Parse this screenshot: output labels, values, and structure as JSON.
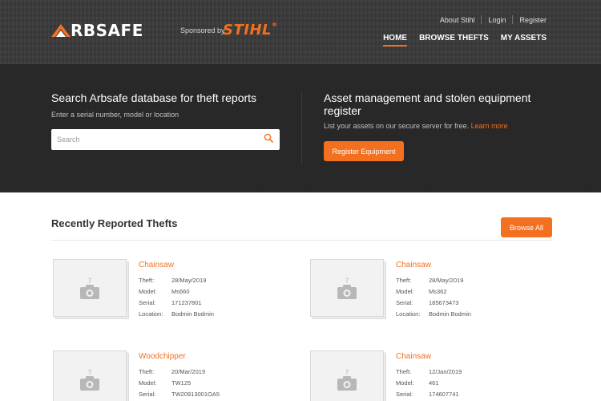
{
  "brand": {
    "logo_text": "RBSAFE",
    "sponsor_text": "Sponsored by",
    "sponsor_name": "STIHL",
    "sponsor_mark": "®"
  },
  "top_links": [
    "About Stihl",
    "Login",
    "Register"
  ],
  "main_nav": [
    {
      "label": "HOME",
      "active": true
    },
    {
      "label": "BROWSE THEFTS",
      "active": false
    },
    {
      "label": "MY ASSETS",
      "active": false
    }
  ],
  "search": {
    "title": "Search Arbsafe database for theft reports",
    "subtitle": "Enter a serial number, model or location",
    "placeholder": "Search"
  },
  "asset": {
    "title": "Asset management and stolen equipment register",
    "subtitle": "List your assets on our secure server for free.",
    "learn_more": "Learn more",
    "button": "Register Equipment"
  },
  "recent": {
    "title": "Recently Reported Thefts",
    "browse_all": "Browse All"
  },
  "labels": {
    "theft": "Theft:",
    "model": "Model:",
    "serial": "Serial:",
    "location": "Location:"
  },
  "thefts": [
    {
      "title": "Chainsaw",
      "theft": "28/May/2019",
      "model": "Ms660",
      "serial": "171237801",
      "location": "Bodmin Bodmin"
    },
    {
      "title": "Chainsaw",
      "theft": "28/May/2019",
      "model": "Ms362",
      "serial": "185673473",
      "location": "Bodmin Bodmin"
    },
    {
      "title": "Woodchipper",
      "theft": "20/Mar/2019",
      "model": "TW125",
      "serial": "TW20913001OA5",
      "location": ""
    },
    {
      "title": "Chainsaw",
      "theft": "12/Jan/2019",
      "model": "461",
      "serial": "174607741",
      "location": ""
    }
  ],
  "colors": {
    "accent": "#f37021",
    "header_bg": "#3a3a3a",
    "hero_bg": "#282828"
  },
  "icons": {
    "search": "magnifier-icon",
    "photo_placeholder": "camera-icon"
  }
}
